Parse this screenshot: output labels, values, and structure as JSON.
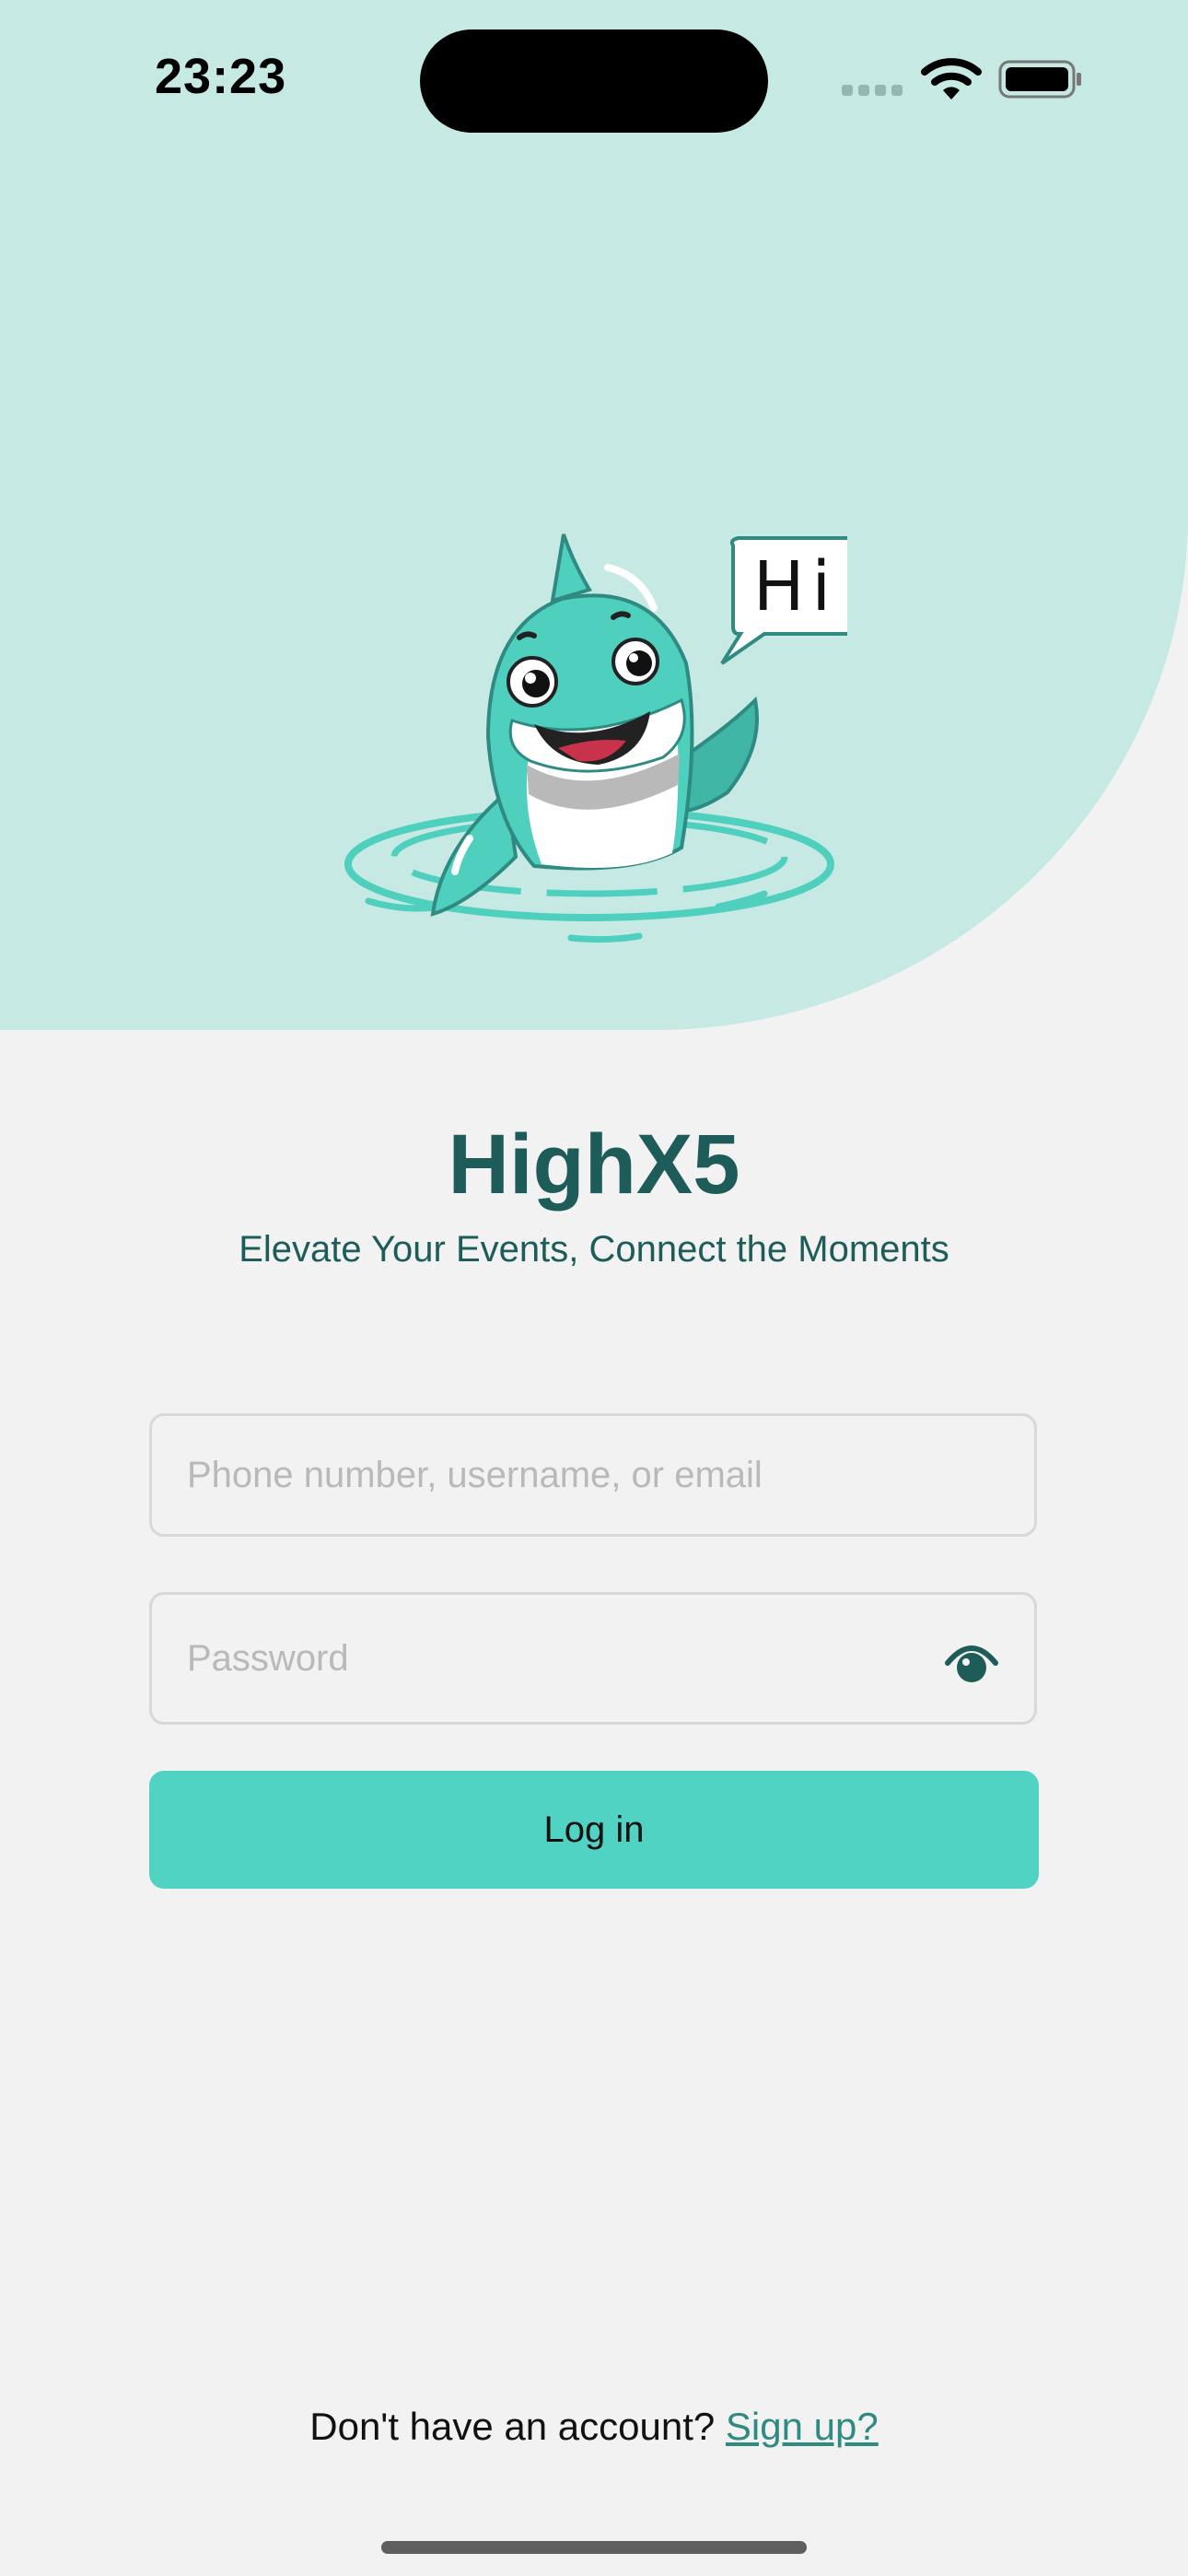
{
  "status_bar": {
    "time": "23:23",
    "icons": [
      "cellular-signal-icon",
      "wifi-icon",
      "battery-icon"
    ]
  },
  "hero": {
    "speech_bubble": "Hi",
    "background_color": "#c6e9e4"
  },
  "branding": {
    "app_name": "HighX5",
    "tagline": "Elevate Your Events, Connect the Moments",
    "primary_color": "#1d5c58"
  },
  "login_form": {
    "identity_field": {
      "placeholder": "Phone number, username, or email",
      "value": ""
    },
    "password_field": {
      "placeholder": "Password",
      "value": "",
      "toggle_icon": "eye-icon"
    },
    "login_button_label": "Log in",
    "accent_color": "#50d3c2"
  },
  "footer": {
    "prompt": "Don't have an account?",
    "signup_link": "Sign up?"
  }
}
